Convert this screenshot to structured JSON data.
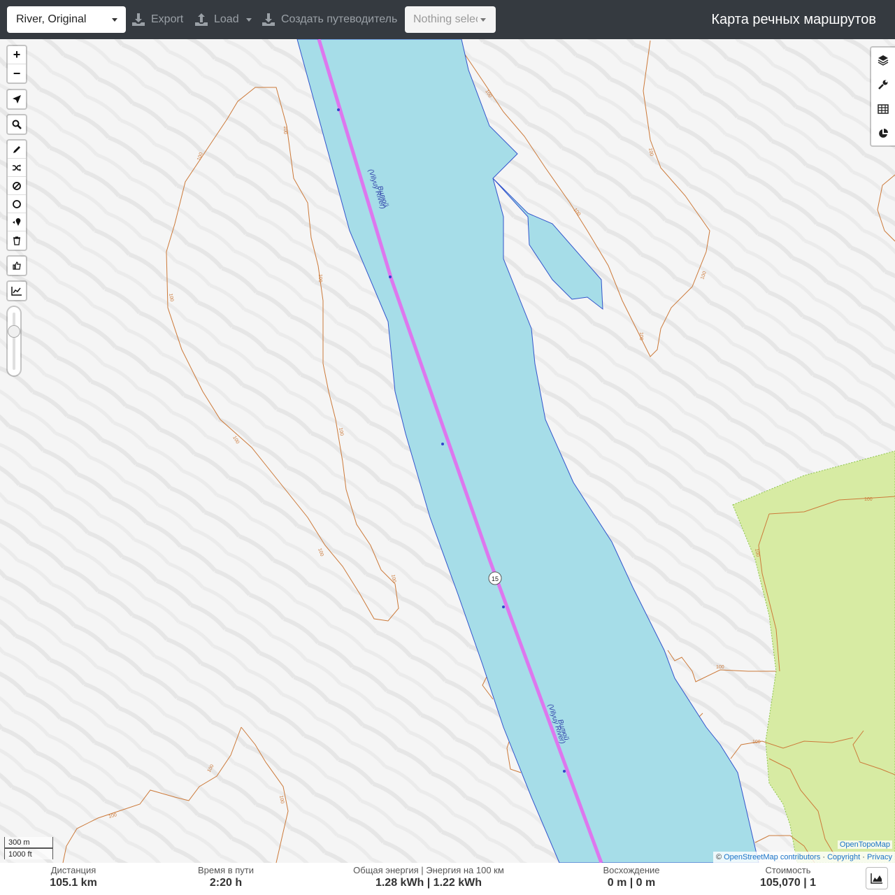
{
  "header": {
    "profile": "River, Original",
    "export_label": "Export",
    "load_label": "Load",
    "guide_label": "Создать путеводитель",
    "select_placeholder": "Nothing selected",
    "app_title": "Карта речных маршрутов"
  },
  "map": {
    "river_name": "Вилюй",
    "river_name_en": "(Vilyuy River)",
    "route_marker": "15",
    "contour_label": "100",
    "colors": {
      "water": "#a6dde8",
      "route": "#dd77ee",
      "contour": "#cc7a3a",
      "forest": "#d7eba3"
    }
  },
  "scale": {
    "metric": "300 m",
    "imperial": "1000 ft"
  },
  "attribution": {
    "tiles": "OpenTopoMap",
    "osm": "OpenStreetMap contributors",
    "copyright": "Copyright",
    "privacy": "Privacy"
  },
  "stats": {
    "distance_label": "Дистанция",
    "distance_value": "105.1 km",
    "time_label": "Время в пути",
    "time_value": "2:20 h",
    "energy_label": "Общая энергия | Энергия на 100 км",
    "energy_value": "1.28 kWh | 1.22 kWh",
    "ascent_label": "Восхождение",
    "ascent_value": "0 m | 0 m",
    "cost_label": "Стоимость",
    "cost_value": "105,070 | 1"
  },
  "icons": {
    "export": "download-icon",
    "load": "upload-icon",
    "guide": "download-icon",
    "layers": "layers-icon",
    "settings": "wrench-icon",
    "table": "table-icon",
    "analysis": "pie-chart-icon",
    "elevation": "area-chart-icon"
  }
}
